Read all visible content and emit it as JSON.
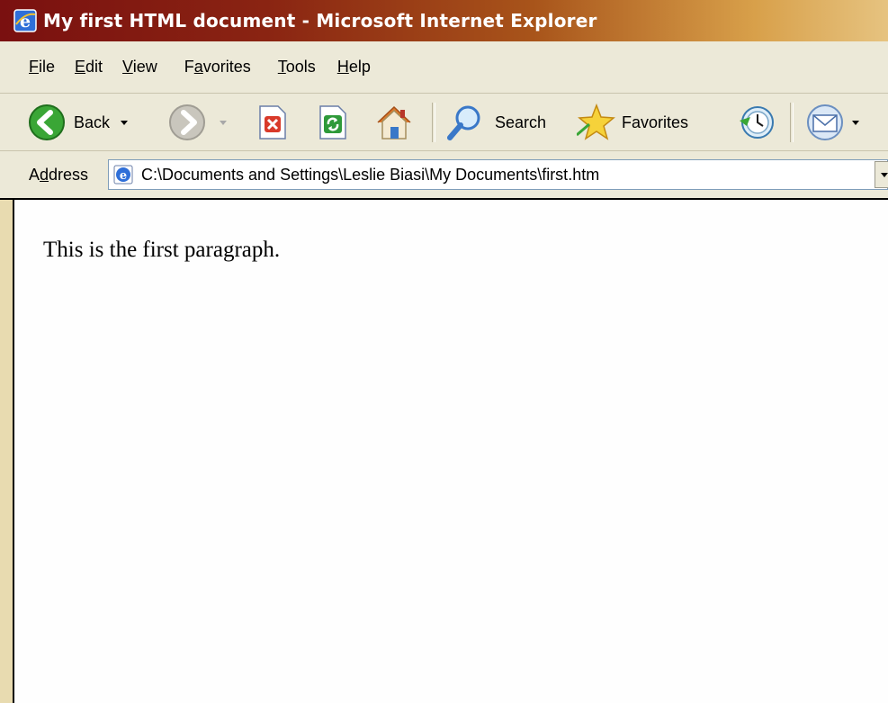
{
  "window": {
    "title": "My first HTML document - Microsoft Internet Explorer",
    "title_icon": "internet-explorer-icon"
  },
  "menu": {
    "items": [
      {
        "label": "File",
        "accel": "F",
        "rest": "ile"
      },
      {
        "label": "Edit",
        "accel": "E",
        "rest": "dit"
      },
      {
        "label": "View",
        "accel": "V",
        "rest": "iew"
      },
      {
        "label": "Favorites",
        "pre": "F",
        "accel": "a",
        "rest": "vorites"
      },
      {
        "label": "Tools",
        "accel": "T",
        "rest": "ools"
      },
      {
        "label": "Help",
        "accel": "H",
        "rest": "elp"
      }
    ]
  },
  "toolbar": {
    "back_label": "Back",
    "search_label": "Search",
    "favorites_label": "Favorites",
    "icons": [
      "back-arrow-icon",
      "forward-arrow-icon",
      "stop-icon",
      "refresh-icon",
      "home-icon",
      "search-magnifier-icon",
      "favorites-star-icon",
      "history-icon",
      "mail-icon"
    ]
  },
  "address": {
    "label": "Address",
    "label_accel": "d",
    "label_pre": "A",
    "label_rest": "dress",
    "value": "C:\\Documents and Settings\\Leslie Biasi\\My Documents\\first.htm"
  },
  "page": {
    "paragraph": "This is the first paragraph."
  },
  "colors": {
    "titlebar_start": "#7a1010",
    "titlebar_end": "#e6c380",
    "chrome": "#ece9d8",
    "content_bg": "#fefefe"
  }
}
